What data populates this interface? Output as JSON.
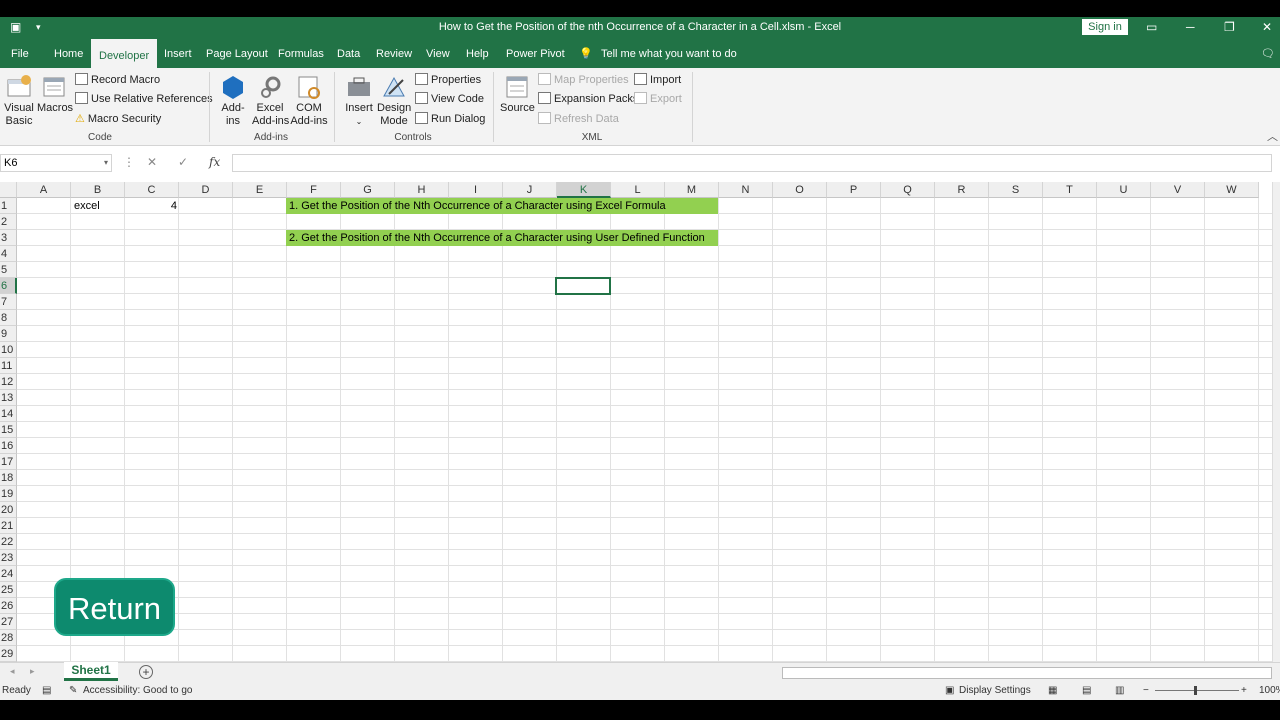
{
  "window": {
    "title": "How to Get the Position of the nth Occurrence of a Character in a Cell.xlsm  -  Excel",
    "signin": "Sign in"
  },
  "tabs": [
    "File",
    "Home",
    "Developer",
    "Insert",
    "Page Layout",
    "Formulas",
    "Data",
    "Review",
    "View",
    "Help",
    "Power Pivot"
  ],
  "active_tab": "Developer",
  "tell_me": "Tell me what you want to do",
  "ribbon": {
    "code": {
      "visual_basic_1": "Visual",
      "visual_basic_2": "Basic",
      "macros": "Macros",
      "record_macro": "Record Macro",
      "relative_refs": "Use Relative References",
      "macro_security": "Macro Security",
      "label": "Code"
    },
    "addins": {
      "addins_1": "Add-",
      "addins_2": "ins",
      "excel_1": "Excel",
      "excel_2": "Add-ins",
      "com_1": "COM",
      "com_2": "Add-ins",
      "label": "Add-ins"
    },
    "controls": {
      "insert": "Insert",
      "design_1": "Design",
      "design_2": "Mode",
      "properties": "Properties",
      "view_code": "View Code",
      "run_dialog": "Run Dialog",
      "label": "Controls"
    },
    "xml": {
      "source": "Source",
      "map_props": "Map Properties",
      "expansion": "Expansion Packs",
      "refresh": "Refresh Data",
      "import": "Import",
      "export": "Export",
      "label": "XML"
    }
  },
  "formula_bar": {
    "name_box": "K6",
    "fx": "fx",
    "value": ""
  },
  "columns": [
    "A",
    "B",
    "C",
    "D",
    "E",
    "F",
    "G",
    "H",
    "I",
    "J",
    "K",
    "L",
    "M",
    "N",
    "O",
    "P",
    "Q",
    "R",
    "S",
    "T",
    "U",
    "V",
    "W"
  ],
  "selected_column": "K",
  "rows": [
    "1",
    "2",
    "3",
    "4",
    "5",
    "6",
    "7",
    "8",
    "9",
    "10",
    "11",
    "12",
    "13",
    "14",
    "15",
    "16",
    "17",
    "18",
    "19",
    "20",
    "21",
    "22",
    "23",
    "24",
    "25",
    "26",
    "27",
    "28",
    "29"
  ],
  "selected_row": "6",
  "cells": {
    "B1": "excel",
    "C1": "4",
    "F1": "1. Get the Position of the Nth Occurrence of a Character using Excel Formula",
    "F3": "2. Get the Position of the Nth Occurrence of a Character using User Defined Function"
  },
  "highlight_color": "#92d050",
  "return_button": "Return",
  "sheet_tab": "Sheet1",
  "status": {
    "ready": "Ready",
    "accessibility": "Accessibility: Good to go",
    "display_settings": "Display Settings",
    "zoom": "100%"
  }
}
